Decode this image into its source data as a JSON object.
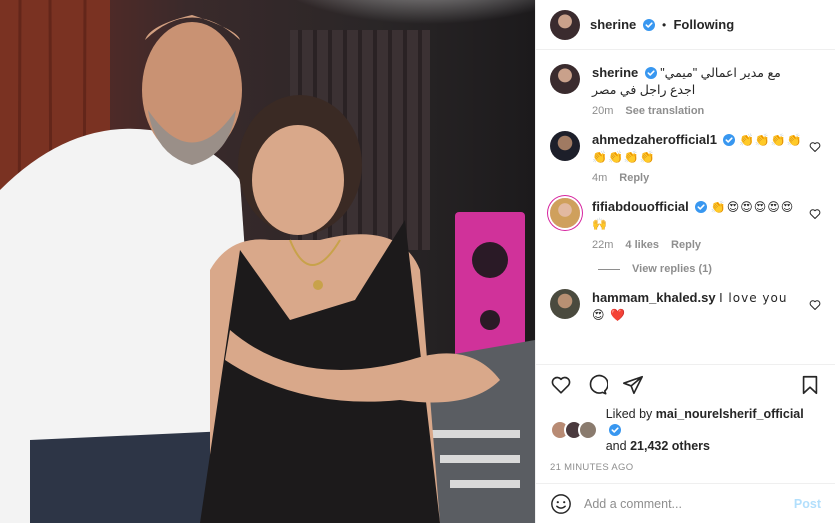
{
  "header": {
    "username": "sherine",
    "separator": "•",
    "follow_state": "Following"
  },
  "caption": {
    "username": "sherine",
    "text": "مع مدير اعمالي \"ميمي\" اجدع راجل في مصر",
    "time": "20m",
    "see_translation": "See translation"
  },
  "comments": [
    {
      "username": "ahmedzaherofficial1",
      "text": "👏👏👏👏👏👏👏👏",
      "time": "4m",
      "reply": "Reply",
      "likes": ""
    },
    {
      "username": "fifiabdouofficial",
      "text": "👏😍😍😍😍😍🙌",
      "time": "22m",
      "likes": "4 likes",
      "reply": "Reply"
    },
    {
      "username": "hammam_khaled.sy",
      "text": "I love you 😍 ❤️",
      "time": "",
      "reply": "",
      "likes": ""
    }
  ],
  "view_replies": "View replies (1)",
  "likes": {
    "prefix": "Liked by",
    "user": "mai_nourelsherif_official",
    "and": "and",
    "others": "21,432 others"
  },
  "timestamp": "21 MINUTES AGO",
  "add_comment": {
    "placeholder": "Add a comment...",
    "post_label": "Post"
  },
  "icons": {
    "header_avatar": "avatar-icon",
    "verified": "verified-badge-icon",
    "like": "heart-icon",
    "comment": "comment-bubble-icon",
    "share": "paper-plane-icon",
    "save": "bookmark-icon",
    "emoji": "smiley-icon"
  },
  "colors": {
    "verified": "#3897f0",
    "post_button_disabled": "#b2dffc",
    "secondary_text": "#8e8e8e"
  }
}
